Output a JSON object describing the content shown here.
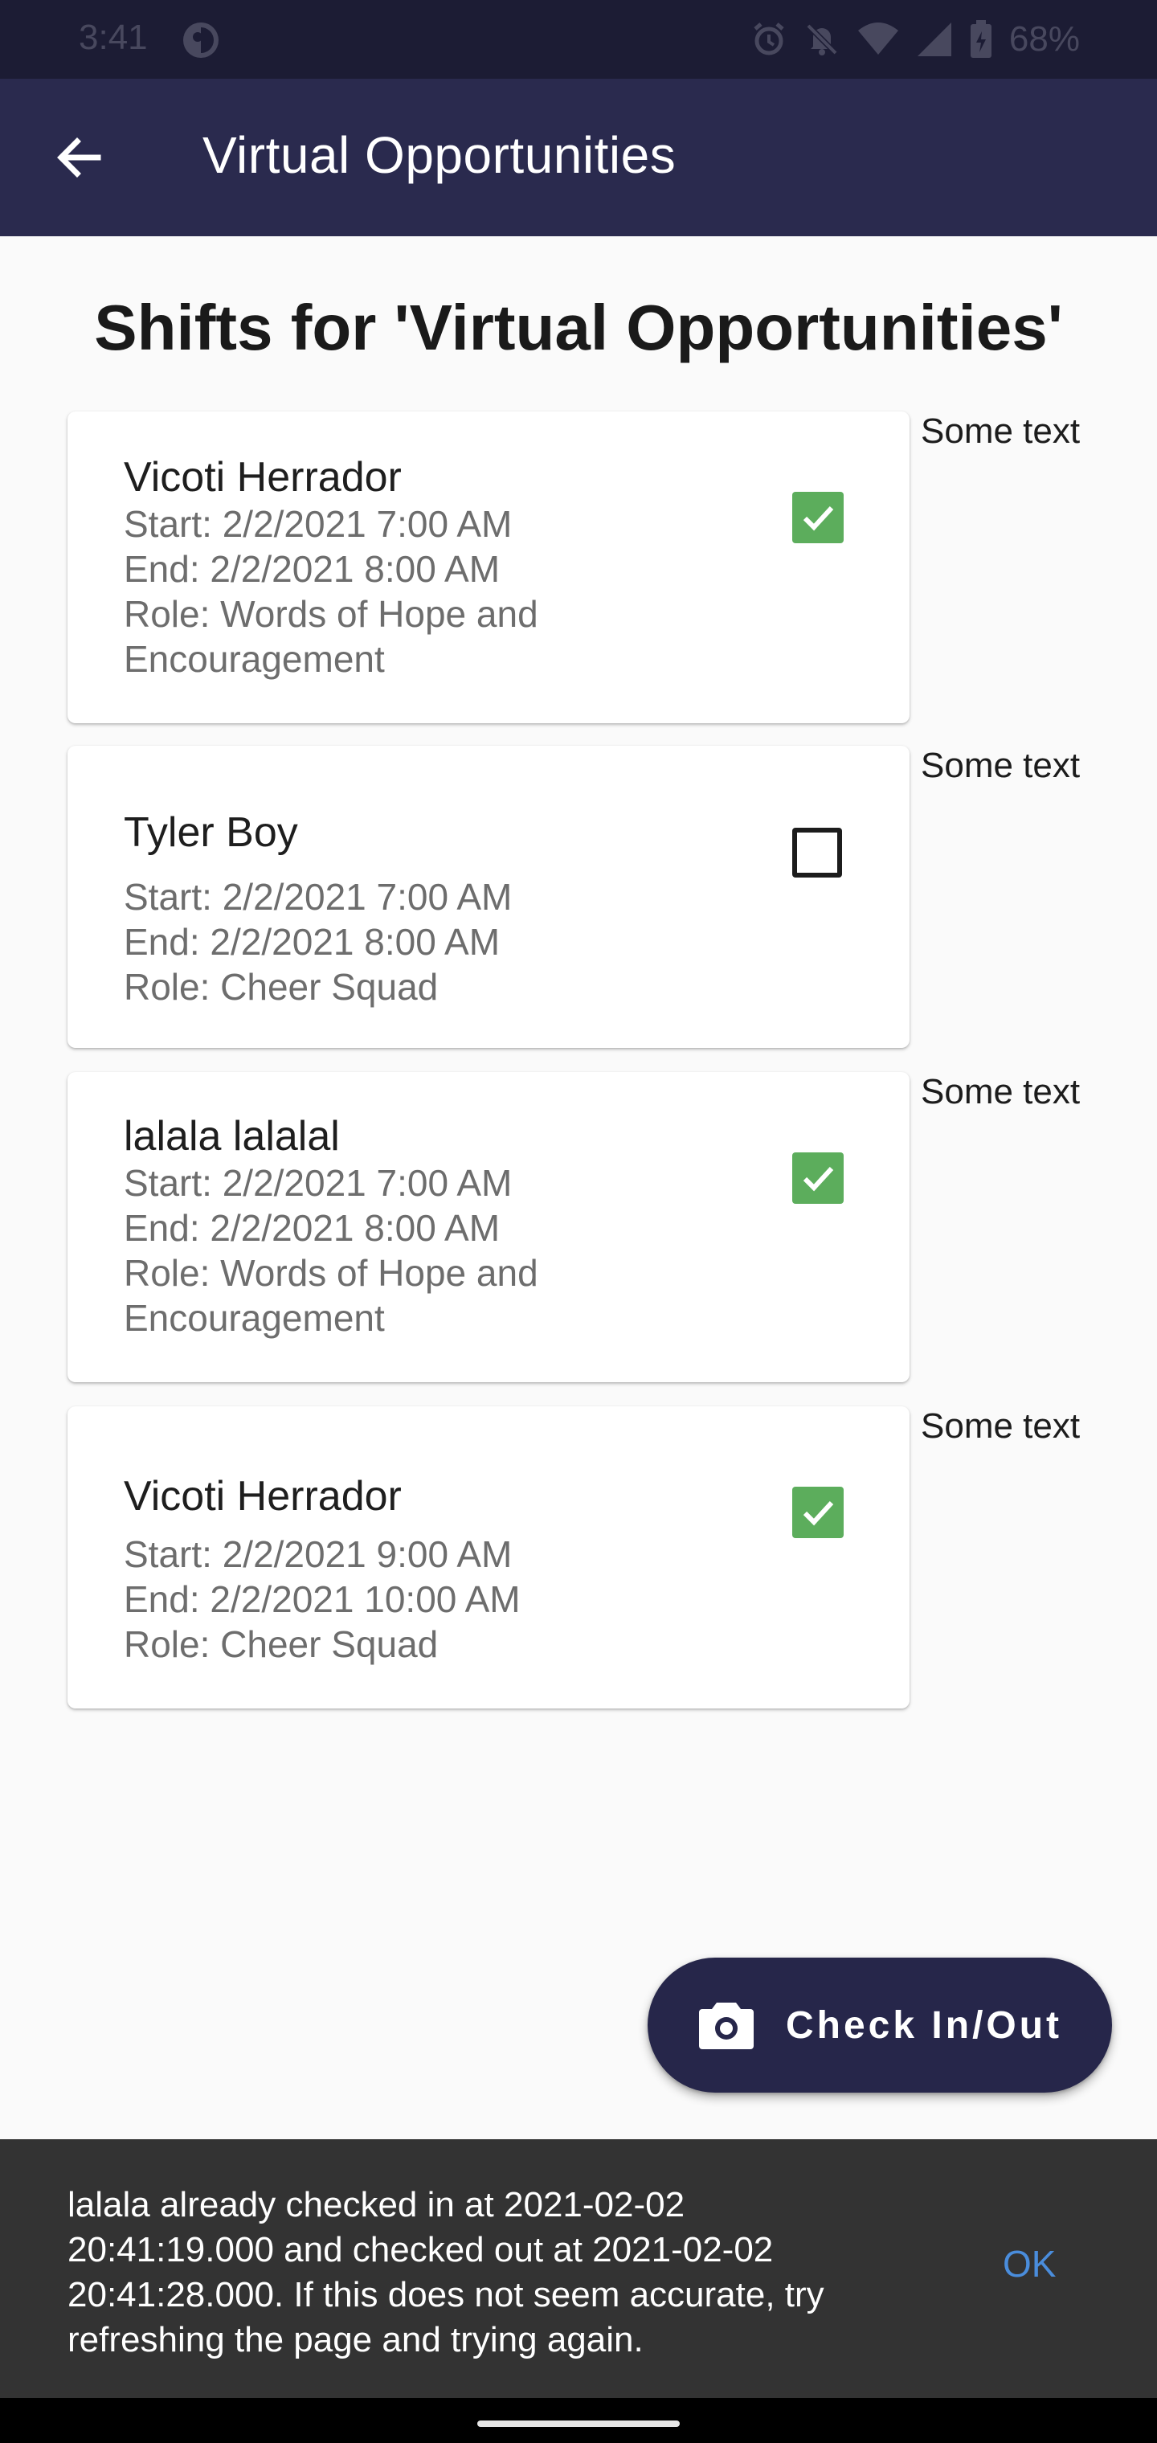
{
  "status_bar": {
    "time": "3:41",
    "battery": "68%",
    "icons": [
      "app-notification-icon",
      "alarm-icon",
      "notifications-off-icon",
      "wifi-icon",
      "cell-signal-icon",
      "battery-icon"
    ]
  },
  "app_bar": {
    "title": "Virtual Opportunities",
    "back_icon": "arrow-left-icon"
  },
  "page": {
    "title": "Shifts for 'Virtual Opportunities'"
  },
  "shifts": [
    {
      "name": "Vicoti Herrador",
      "start": "Start: 2/2/2021 7:00 AM",
      "end": "End: 2/2/2021 8:00 AM",
      "role_line1": "Role: Words of Hope and",
      "role_line2": "Encouragement",
      "checked": true,
      "side_text": "Some text"
    },
    {
      "name": "Tyler Boy",
      "start": "Start: 2/2/2021 7:00 AM",
      "end": "End: 2/2/2021 8:00 AM",
      "role_line1": "Role: Cheer Squad",
      "role_line2": "",
      "checked": false,
      "side_text": "Some text"
    },
    {
      "name": "lalala lalalal",
      "start": "Start: 2/2/2021 7:00 AM",
      "end": "End: 2/2/2021 8:00 AM",
      "role_line1": "Role: Words of Hope and",
      "role_line2": "Encouragement",
      "checked": true,
      "side_text": "Some text"
    },
    {
      "name": "Vicoti Herrador",
      "start": "Start: 2/2/2021 9:00 AM",
      "end": "End: 2/2/2021 10:00 AM",
      "role_line1": "Role: Cheer Squad",
      "role_line2": "",
      "checked": true,
      "side_text": "Some text"
    }
  ],
  "fab": {
    "label": "Check In/Out",
    "icon": "camera-icon"
  },
  "snackbar": {
    "message": "lalala already checked in at 2021-02-02 20:41:19.000 and checked out at 2021-02-02 20:41:28.000. If this does not seem accurate, try refreshing the page and trying again.",
    "action": "OK"
  },
  "colors": {
    "status_bar": "#1c1c34",
    "app_bar": "#2a2a4e",
    "fab": "#26264a",
    "checkbox_checked": "#5cad5c",
    "snackbar": "#333333",
    "snackbar_action": "#4a8ddc"
  }
}
